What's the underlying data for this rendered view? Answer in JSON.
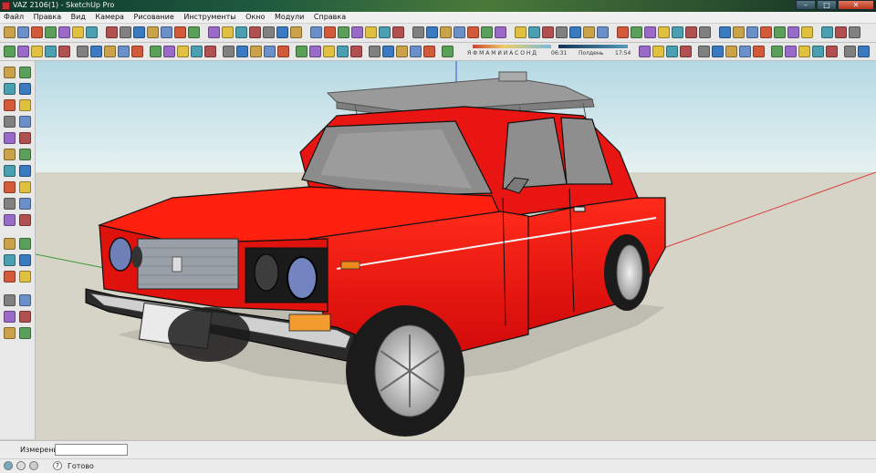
{
  "window": {
    "title": "VAZ 2106(1) - SketchUp Pro"
  },
  "menu": [
    "Файл",
    "Правка",
    "Вид",
    "Камера",
    "Рисование",
    "Инструменты",
    "Окно",
    "Модули",
    "Справка"
  ],
  "shadow_settings": {
    "months": "Я Ф М А М И И А С О Н Д",
    "time_start": "06:31",
    "time_mid": "Полдень",
    "time_end": "17:54"
  },
  "measurements": {
    "label": "Измерения",
    "value": ""
  },
  "status": {
    "text": "Готово"
  },
  "colors": {
    "car_body": "#e01010",
    "sky": "#c8e3ea",
    "ground": "#d6d3c7",
    "toolbar": "#e8e8e8"
  },
  "icons": {
    "toolbar_top": [
      "new-icon",
      "open-icon",
      "save-icon",
      "cut-icon",
      "copy-icon",
      "paste-icon",
      "erase-icon",
      "undo-icon",
      "redo-icon",
      "print-icon",
      "select-icon",
      "pencil-icon",
      "rectangle-icon",
      "circle-icon",
      "arc-icon",
      "polygon-icon",
      "eraser-icon",
      "paint-icon",
      "push-pull-icon",
      "follow-me-icon",
      "offset-icon",
      "move-icon",
      "rotate-icon",
      "scale-icon",
      "tape-icon",
      "dimension-icon",
      "protractor-icon",
      "text-icon",
      "axes-icon",
      "3d-text-icon",
      "orbit-icon",
      "pan-icon",
      "zoom-icon",
      "zoom-window-icon",
      "zoom-extents-icon",
      "previous-icon",
      "next-icon",
      "position-camera-icon",
      "walk-icon",
      "look-around-icon",
      "section-plane-icon",
      "iso-view-icon",
      "top-view-icon",
      "front-view-icon",
      "right-view-icon",
      "back-view-icon",
      "left-view-icon",
      "xray-icon",
      "wireframe-icon",
      "hidden-line-icon",
      "shaded-icon",
      "textured-icon",
      "monochrome-icon",
      "layers-icon",
      "components-icon",
      "materials-icon",
      "styles-icon",
      "scenes-icon",
      "shadows-icon",
      "fog-icon"
    ],
    "toolbar_left": [
      "select-icon",
      "make-component-icon",
      "paint-bucket-icon",
      "eraser-icon",
      "rectangle-icon",
      "line-icon",
      "circle-icon",
      "arc-icon",
      "polygon-icon",
      "freehand-icon",
      "move-icon",
      "push-pull-icon",
      "rotate-icon",
      "follow-me-icon",
      "scale-icon",
      "offset-icon",
      "tape-measure-icon",
      "dimension-icon",
      "protractor-icon",
      "text-icon",
      "axes-icon",
      "3d-text-icon",
      "orbit-icon",
      "pan-icon",
      "zoom-icon",
      "zoom-window-icon",
      "zoom-extents-icon",
      "previous-view-icon",
      "position-camera-icon",
      "look-around-icon",
      "walk-icon",
      "section-plane-icon"
    ]
  }
}
